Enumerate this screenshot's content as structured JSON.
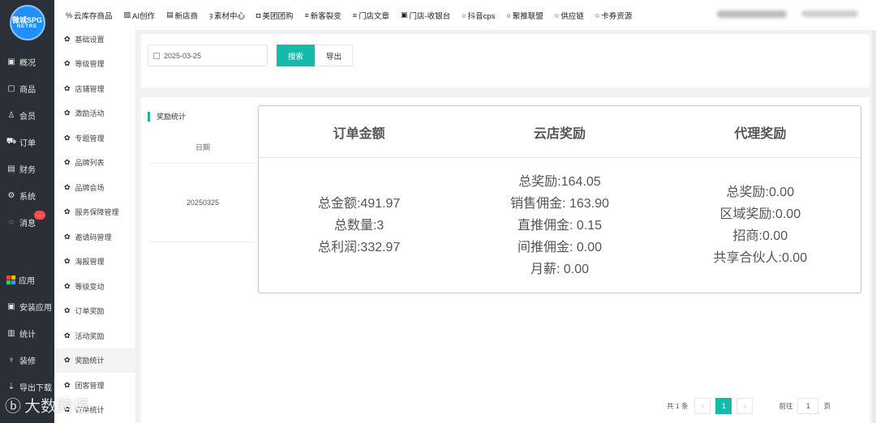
{
  "logo": {
    "line1": "微城SPG",
    "line2": "NETRE"
  },
  "sidebar": {
    "items": [
      {
        "label": "概况",
        "icon": "dashboard-icon"
      },
      {
        "label": "商品",
        "icon": "product-icon"
      },
      {
        "label": "会员",
        "icon": "members-icon"
      },
      {
        "label": "订单",
        "icon": "cart-icon"
      },
      {
        "label": "财务",
        "icon": "finance-icon"
      },
      {
        "label": "系统",
        "icon": "gear-icon"
      },
      {
        "label": "消息",
        "icon": "message-icon",
        "badge": "..."
      }
    ],
    "bottom_items": [
      {
        "label": "应用",
        "icon": "apps-icon"
      },
      {
        "label": "安装应用",
        "icon": "install-icon"
      },
      {
        "label": "统计",
        "icon": "chart-icon"
      },
      {
        "label": "装修",
        "icon": "decorate-icon"
      },
      {
        "label": "导出下载",
        "icon": "download-icon"
      }
    ]
  },
  "submenu": {
    "items": [
      "基础设置",
      "等级管理",
      "店铺管理",
      "激励活动",
      "专题管理",
      "品牌列表",
      "品牌会场",
      "服务保障管理",
      "邀请码管理",
      "海报管理",
      "等级变动",
      "订单奖励",
      "活动奖励",
      "奖励统计",
      "团客管理",
      "订单统计"
    ],
    "active_index": 13
  },
  "topnav": {
    "items": [
      {
        "label": "云库存商品",
        "icon": "%"
      },
      {
        "label": "AI创作",
        "icon": "▧"
      },
      {
        "label": "新店商",
        "icon": "▤"
      },
      {
        "label": "素材中心",
        "icon": "ȝ"
      },
      {
        "label": "美团团购",
        "icon": "◘"
      },
      {
        "label": "新客裂变",
        "icon": "≡"
      },
      {
        "label": "门店文章",
        "icon": "≡"
      },
      {
        "label": "门店-收银台",
        "icon": "▣"
      },
      {
        "label": "抖音cps",
        "icon": "○"
      },
      {
        "label": "聚推联盟",
        "icon": "○"
      },
      {
        "label": "供应链",
        "icon": "○"
      },
      {
        "label": "卡券资源",
        "icon": "○"
      }
    ]
  },
  "filter": {
    "date_value": "2025-03-25",
    "search_label": "搜索",
    "export_label": "导出"
  },
  "content": {
    "section_title": "奖励统计",
    "date_header": "日期",
    "date_value": "20250325",
    "columns": [
      {
        "title": "订单金额",
        "lines": [
          "总金额:491.97",
          "总数量:3",
          "总利润:332.97"
        ]
      },
      {
        "title": "云店奖励",
        "lines": [
          "总奖励:164.05",
          "销售佣金: 163.90",
          "直推佣金: 0.15",
          "间推佣金: 0.00",
          "月薪: 0.00"
        ]
      },
      {
        "title": "代理奖励",
        "lines": [
          "总奖励:0.00",
          "区域奖励:0.00",
          "招商:0.00",
          "共享合伙人:0.00"
        ]
      }
    ]
  },
  "pagination": {
    "total": "共 1 条",
    "prev": "‹",
    "current": "1",
    "next": "›",
    "goto_label": "前往",
    "goto_value": "1",
    "page_suffix": "页"
  },
  "watermark": "大数跨境"
}
